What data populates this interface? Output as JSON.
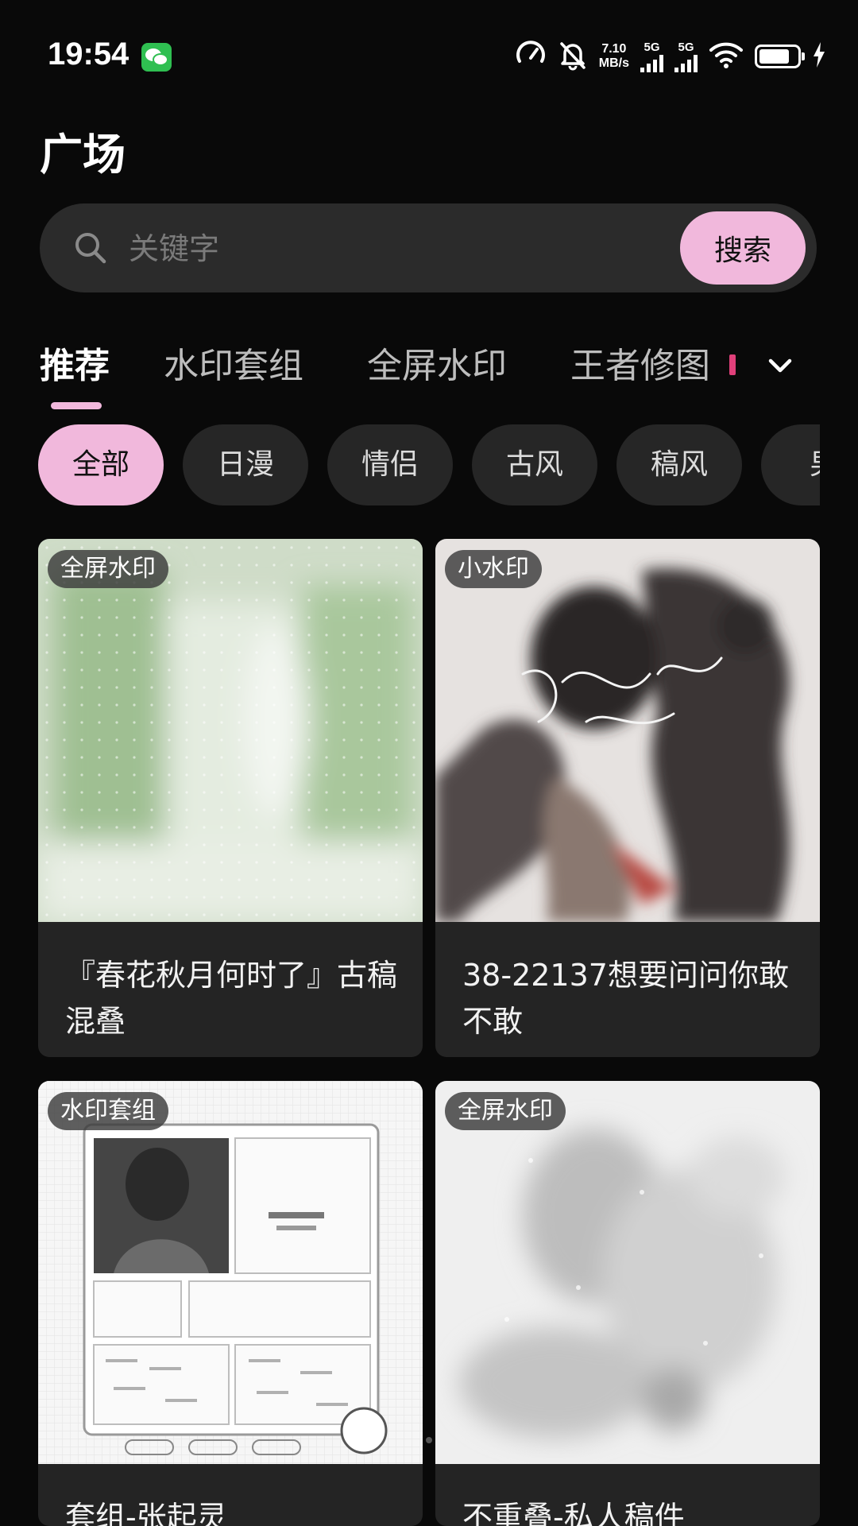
{
  "status_bar": {
    "time": "19:54",
    "net_speed_value": "7.10",
    "net_speed_unit": "MB/s",
    "sim1_label": "5G",
    "sim2_label": "5G",
    "battery_level": 0.8,
    "icons": [
      "wechat-icon",
      "speed-dial-icon",
      "bell-muted-icon",
      "signal-icon",
      "wifi-icon",
      "battery-icon",
      "charging-icon"
    ]
  },
  "page": {
    "title": "广场"
  },
  "search": {
    "placeholder": "关键字",
    "value": "",
    "button_label": "搜索"
  },
  "tabs": [
    {
      "label": "推荐",
      "active": true
    },
    {
      "label": "水印套组",
      "active": false
    },
    {
      "label": "全屏水印",
      "active": false
    },
    {
      "label": "王者修图",
      "active": false
    }
  ],
  "chips": [
    {
      "label": "全部",
      "active": true
    },
    {
      "label": "日漫",
      "active": false
    },
    {
      "label": "情侣",
      "active": false
    },
    {
      "label": "古风",
      "active": false
    },
    {
      "label": "稿风",
      "active": false
    },
    {
      "label": "男",
      "active": false
    }
  ],
  "cards": [
    {
      "tag": "全屏水印",
      "title": "『春花秋月何时了』古稿混叠"
    },
    {
      "tag": "小水印",
      "title": "38-22137想要问问你敢不敢"
    },
    {
      "tag": "水印套组",
      "title": "套组-张起灵"
    },
    {
      "tag": "全屏水印",
      "title": "不重叠-私人稿件"
    }
  ],
  "colors": {
    "background": "#090909",
    "accent_pink": "#f1b8dc",
    "surface": "#242424",
    "chip_bg": "#262626",
    "tab_badge": "#e0407a"
  }
}
